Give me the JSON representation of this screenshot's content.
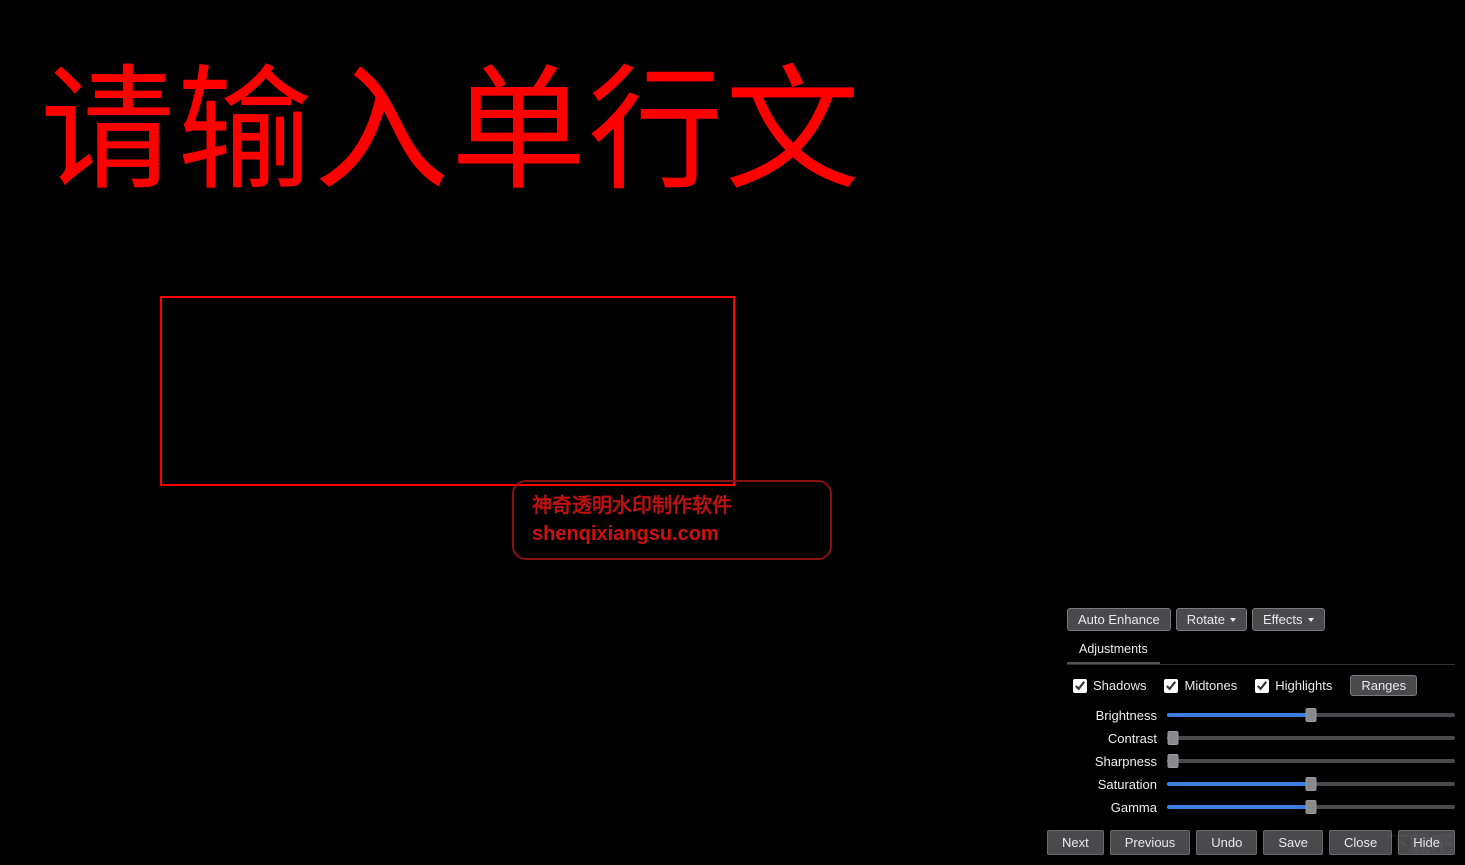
{
  "canvas": {
    "main_text": "请输入单行文",
    "watermark_line1": "神奇透明水印制作软件",
    "watermark_line2": "shenqixiangsu.com"
  },
  "toolbar": {
    "auto_enhance": "Auto Enhance",
    "rotate": "Rotate",
    "effects": "Effects"
  },
  "tabs": {
    "adjustments": "Adjustments"
  },
  "checks": {
    "shadows": {
      "label": "Shadows",
      "checked": true
    },
    "midtones": {
      "label": "Midtones",
      "checked": true
    },
    "highlights": {
      "label": "Highlights",
      "checked": true
    },
    "ranges_button": "Ranges"
  },
  "sliders": {
    "brightness": {
      "label": "Brightness",
      "value": 50
    },
    "contrast": {
      "label": "Contrast",
      "value": 2
    },
    "sharpness": {
      "label": "Sharpness",
      "value": 2
    },
    "saturation": {
      "label": "Saturation",
      "value": 50
    },
    "gamma": {
      "label": "Gamma",
      "value": 50
    }
  },
  "bottom": {
    "next": "Next",
    "previous": "Previous",
    "undo": "Undo",
    "save": "Save",
    "close": "Close",
    "hide": "Hide"
  },
  "bg_watermark": "下载吧"
}
